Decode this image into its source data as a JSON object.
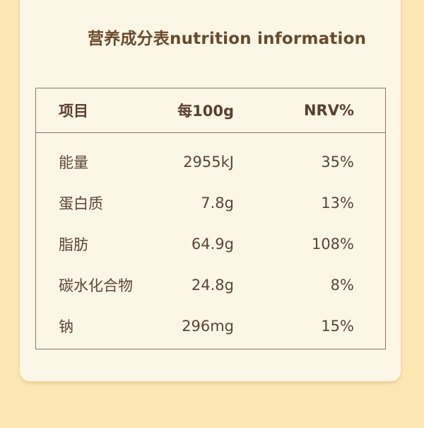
{
  "title": "营养成分表nutrition information",
  "table": {
    "headers": {
      "item": "项目",
      "per100g": "每100g",
      "nrv": "NRV%"
    },
    "rows": [
      {
        "item": "能量",
        "per100g": "2955kJ",
        "nrv": "35%"
      },
      {
        "item": "蛋白质",
        "per100g": "7.8g",
        "nrv": "13%"
      },
      {
        "item": "脂肪",
        "per100g": "64.9g",
        "nrv": "108%"
      },
      {
        "item": "碳水化合物",
        "per100g": "24.8g",
        "nrv": "8%"
      },
      {
        "item": "钠",
        "per100g": "296mg",
        "nrv": "15%"
      }
    ]
  },
  "colors": {
    "background": "#fbe7b4",
    "card": "#fcf6e6",
    "title": "#6b4a2d",
    "text": "#5a4636",
    "border": "#8c7560"
  }
}
